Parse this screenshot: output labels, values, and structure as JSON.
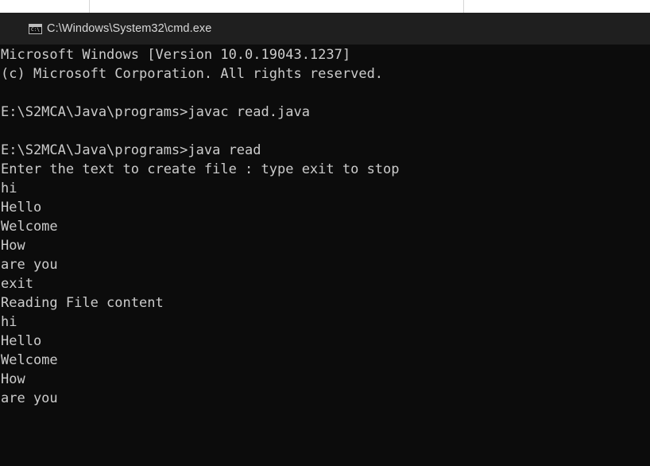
{
  "window": {
    "title": "C:\\Windows\\System32\\cmd.exe",
    "icon": "cmd-icon",
    "icon_glyph": "C:\\"
  },
  "colors": {
    "console_bg": "#0c0c0c",
    "console_fg": "#cccccc",
    "titlebar_bg": "#1f1f1f",
    "title_fg": "#d8d8d8"
  },
  "console": {
    "lines": [
      "Microsoft Windows [Version 10.0.19043.1237]",
      "(c) Microsoft Corporation. All rights reserved.",
      "",
      "E:\\S2MCA\\Java\\programs>javac read.java",
      "",
      "E:\\S2MCA\\Java\\programs>java read",
      "Enter the text to create file : type exit to stop",
      "hi",
      "Hello",
      "Welcome",
      "How",
      "are you",
      "exit",
      "Reading File content",
      "hi",
      "Hello",
      "Welcome",
      "How",
      "are you"
    ]
  }
}
